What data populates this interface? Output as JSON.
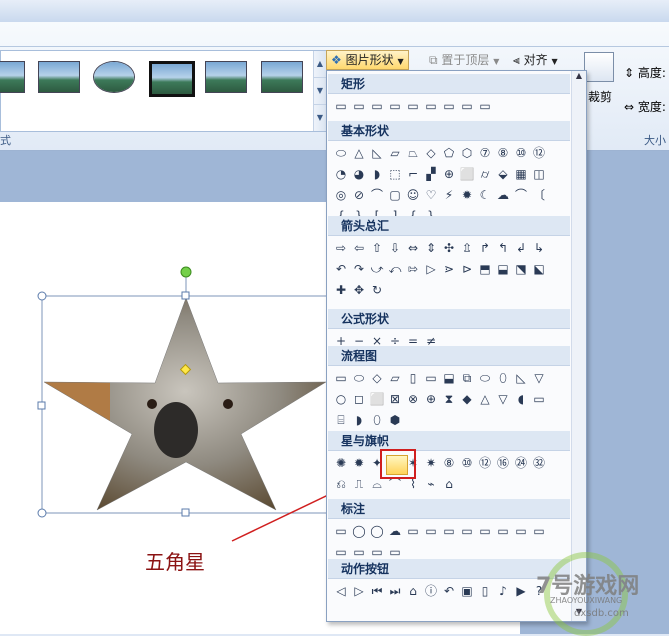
{
  "ribbon": {
    "picture_shape_btn": "图片形状",
    "bring_front_btn": "置于顶层",
    "align_btn": "对齐",
    "crop_btn": "裁剪",
    "height_label": "高度:",
    "width_label": "宽度:",
    "styles_group": "式",
    "size_group": "大小"
  },
  "shapes_menu": {
    "sections": [
      {
        "title": "矩形",
        "rows": [
          [
            "▭",
            "▭",
            "▭",
            "▭",
            "▭",
            "▭",
            "▭",
            "▭",
            "▭"
          ]
        ]
      },
      {
        "title": "基本形状",
        "rows": [
          [
            "⬭",
            "△",
            "◺",
            "▱",
            "⏢",
            "◇",
            "⬠",
            "⬡",
            "⑦",
            "⑧",
            "⑩",
            "⑫"
          ],
          [
            "◔",
            "◕",
            "◗",
            "⬚",
            "⌐",
            "▞",
            "⊕",
            "⬜",
            "⌭",
            "⬙",
            "▦",
            "◫"
          ],
          [
            "◎",
            "⊘",
            "⌒",
            "▢",
            "☺",
            "♡",
            "⚡",
            "✹",
            "☾",
            "☁",
            "⌒",
            "〔"
          ],
          [
            "{",
            "}",
            "[",
            "]",
            "{",
            "}"
          ]
        ]
      },
      {
        "title": "箭头总汇",
        "rows": [
          [
            "⇨",
            "⇦",
            "⇧",
            "⇩",
            "⇔",
            "⇕",
            "✣",
            "⇫",
            "↱",
            "↰",
            "↲",
            "↳"
          ],
          [
            "↶",
            "↷",
            "⤻",
            "⤺",
            "⇰",
            "▷",
            "⋗",
            "⊳",
            "⬒",
            "⬓",
            "⬔",
            "⬕"
          ],
          [
            "✚",
            "✥",
            "↻"
          ]
        ]
      },
      {
        "title": "公式形状",
        "rows": [
          [
            "+",
            "−",
            "×",
            "÷",
            "=",
            "≠"
          ]
        ]
      },
      {
        "title": "流程图",
        "rows": [
          [
            "▭",
            "⬭",
            "◇",
            "▱",
            "▯",
            "▭",
            "⬓",
            "⧉",
            "⬭",
            "⬯",
            "◺",
            "▽"
          ],
          [
            "○",
            "◻",
            "⬜",
            "⊠",
            "⊗",
            "⊕",
            "⧗",
            "◆",
            "△",
            "▽",
            "◖",
            "▭"
          ],
          [
            "⌸",
            "◗",
            "⬯",
            "⬢"
          ]
        ]
      },
      {
        "title": "星与旗帜",
        "rows": [
          [
            "✺",
            "✹",
            "✦",
            "★",
            "✶",
            "✷",
            "⑧",
            "⑩",
            "⑫",
            "⑯",
            "㉔",
            "㉜"
          ],
          [
            "⎌",
            "⎍",
            "⌓",
            "⌒",
            "⌇",
            "⌁",
            "⌂"
          ]
        ]
      },
      {
        "title": "标注",
        "rows": [
          [
            "▭",
            "◯",
            "◯",
            "☁",
            "▭",
            "▭",
            "▭",
            "▭",
            "▭",
            "▭",
            "▭",
            "▭"
          ],
          [
            "▭",
            "▭",
            "▭",
            "▭"
          ]
        ]
      },
      {
        "title": "动作按钮",
        "rows": [
          [
            "◁",
            "▷",
            "⏮",
            "⏭",
            "⌂",
            "ⓘ",
            "↶",
            "▣",
            "▯",
            "♪",
            "▶",
            "?"
          ]
        ]
      }
    ]
  },
  "annotation": {
    "text": "五角星"
  },
  "watermark": {
    "big": "7号游戏网",
    "small": "ZHAOYOUXIWANG",
    "url": "dxsdb.com"
  }
}
